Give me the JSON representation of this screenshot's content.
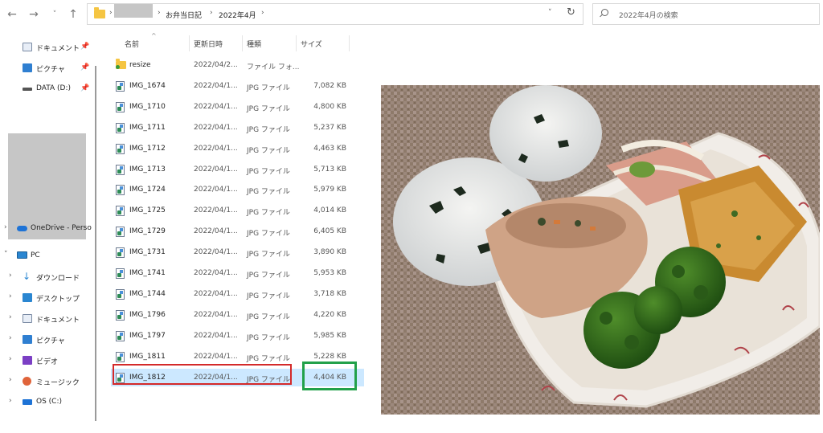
{
  "nav": {
    "back": "←",
    "forward": "→",
    "recent": "˅",
    "up": "↑"
  },
  "address": {
    "crumb_sep": "›",
    "crumbs": [
      "お弁当日記",
      "2022年4月"
    ],
    "dropdown": "˅",
    "refresh": "↻"
  },
  "search": {
    "placeholder": "2022年4月の検索"
  },
  "sidebar": {
    "quick": [
      {
        "label": "ドキュメント",
        "pin": "📌"
      },
      {
        "label": "ピクチャ",
        "pin": "📌"
      },
      {
        "label": "DATA (D:)",
        "pin": "📌"
      }
    ],
    "onedrive": "OneDrive - Perso",
    "pc": "PC",
    "pc_items": [
      {
        "label": "ダウンロード"
      },
      {
        "label": "デスクトップ"
      },
      {
        "label": "ドキュメント"
      },
      {
        "label": "ピクチャ"
      },
      {
        "label": "ビデオ"
      },
      {
        "label": "ミュージック"
      },
      {
        "label": "OS (C:)"
      }
    ]
  },
  "columns": {
    "name": "名前",
    "date": "更新日時",
    "type": "種類",
    "size": "サイズ",
    "sort_indicator": "^"
  },
  "files": [
    {
      "name": "resize",
      "date": "2022/04/2...",
      "type": "ファイル フォ...",
      "size": "",
      "folder": true
    },
    {
      "name": "IMG_1674",
      "date": "2022/04/1...",
      "type": "JPG ファイル",
      "size": "7,082 KB"
    },
    {
      "name": "IMG_1710",
      "date": "2022/04/1...",
      "type": "JPG ファイル",
      "size": "4,800 KB"
    },
    {
      "name": "IMG_1711",
      "date": "2022/04/1...",
      "type": "JPG ファイル",
      "size": "5,237 KB"
    },
    {
      "name": "IMG_1712",
      "date": "2022/04/1...",
      "type": "JPG ファイル",
      "size": "4,463 KB"
    },
    {
      "name": "IMG_1713",
      "date": "2022/04/1...",
      "type": "JPG ファイル",
      "size": "5,713 KB"
    },
    {
      "name": "IMG_1724",
      "date": "2022/04/1...",
      "type": "JPG ファイル",
      "size": "5,979 KB"
    },
    {
      "name": "IMG_1725",
      "date": "2022/04/1...",
      "type": "JPG ファイル",
      "size": "4,014 KB"
    },
    {
      "name": "IMG_1729",
      "date": "2022/04/1...",
      "type": "JPG ファイル",
      "size": "6,405 KB"
    },
    {
      "name": "IMG_1731",
      "date": "2022/04/1...",
      "type": "JPG ファイル",
      "size": "3,890 KB"
    },
    {
      "name": "IMG_1741",
      "date": "2022/04/1...",
      "type": "JPG ファイル",
      "size": "5,953 KB"
    },
    {
      "name": "IMG_1744",
      "date": "2022/04/1...",
      "type": "JPG ファイル",
      "size": "3,718 KB"
    },
    {
      "name": "IMG_1796",
      "date": "2022/04/1...",
      "type": "JPG ファイル",
      "size": "4,220 KB"
    },
    {
      "name": "IMG_1797",
      "date": "2022/04/1...",
      "type": "JPG ファイル",
      "size": "5,985 KB"
    },
    {
      "name": "IMG_1811",
      "date": "2022/04/1...",
      "type": "JPG ファイル",
      "size": "5,228 KB"
    },
    {
      "name": "IMG_1812",
      "date": "2022/04/1...",
      "type": "JPG ファイル",
      "size": "4,404 KB",
      "selected": true
    }
  ],
  "colors": {
    "selection": "#cce8ff",
    "highlight_red": "#d42a2a",
    "highlight_green": "#22a14a",
    "folder_yellow": "#f5c542"
  }
}
